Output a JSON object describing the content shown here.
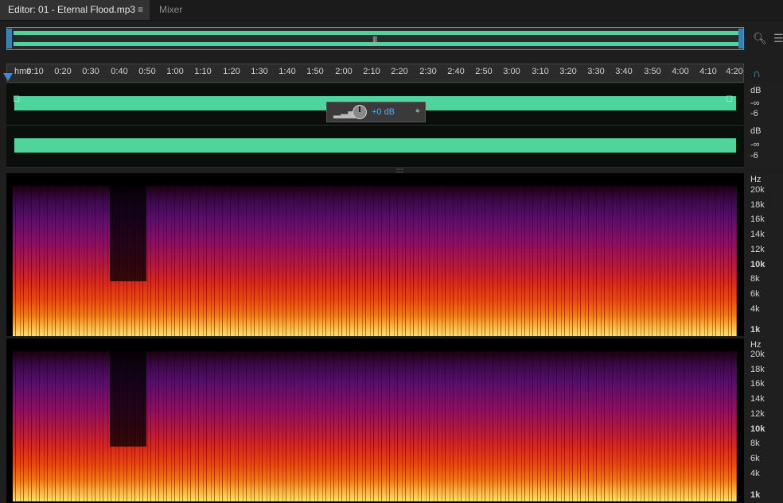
{
  "tabs": {
    "editor": "Editor: 01 - Eternal Flood.mp3",
    "editor_menu": "≡",
    "mixer": "Mixer"
  },
  "overview": {
    "grip": "||||"
  },
  "ruler": {
    "unit": "hms",
    "labels": [
      "0:10",
      "0:20",
      "0:30",
      "0:40",
      "0:50",
      "1:00",
      "1:10",
      "1:20",
      "1:30",
      "1:40",
      "1:50",
      "2:00",
      "2:10",
      "2:20",
      "2:30",
      "2:40",
      "2:50",
      "3:00",
      "3:10",
      "3:20",
      "3:30",
      "3:40",
      "3:50",
      "4:00",
      "4:10",
      "4:20"
    ]
  },
  "hud": {
    "value": "+0 dB"
  },
  "db_scale": {
    "ch1": {
      "unit": "dB",
      "inf": "-∞",
      "neg6": "-6"
    },
    "ch2": {
      "unit": "dB",
      "inf": "-∞",
      "neg6": "-6"
    }
  },
  "hz_scale": {
    "unit": "Hz",
    "labels": [
      "20k",
      "18k",
      "16k",
      "14k",
      "12k",
      "10k",
      "8k",
      "6k",
      "4k",
      "1k"
    ]
  },
  "colors": {
    "waveform": "#4fd49c",
    "accent": "#3a8ad8",
    "hud_value": "#5aa8f0"
  }
}
